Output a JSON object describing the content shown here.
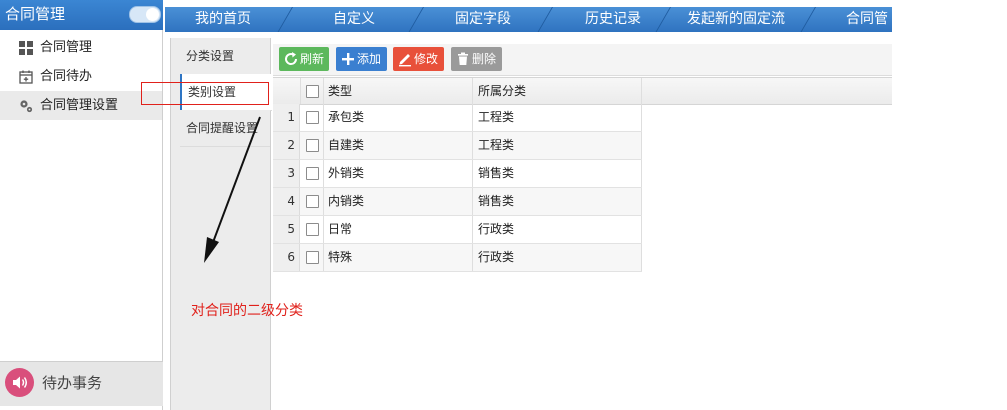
{
  "sidebar": {
    "title": "合同管理",
    "items": [
      {
        "label": "合同管理",
        "icon": "grid-icon"
      },
      {
        "label": "合同待办",
        "icon": "calendar-add-icon"
      },
      {
        "label": "合同管理设置",
        "icon": "gears-icon"
      }
    ],
    "footer_label": "待办事务"
  },
  "topnav": {
    "tabs": [
      "我的首页",
      "自定义",
      "固定字段",
      "历史记录",
      "发起新的固定流",
      "合同管"
    ]
  },
  "subtabs": [
    "分类设置",
    "类别设置",
    "合同提醒设置"
  ],
  "toolbar": {
    "refresh": "刷新",
    "add": "添加",
    "edit": "修改",
    "delete": "删除"
  },
  "grid": {
    "columns": [
      "类型",
      "所属分类"
    ],
    "rows": [
      {
        "n": "1",
        "type": "承包类",
        "category": "工程类"
      },
      {
        "n": "2",
        "type": "自建类",
        "category": "工程类"
      },
      {
        "n": "3",
        "type": "外销类",
        "category": "销售类"
      },
      {
        "n": "4",
        "type": "内销类",
        "category": "销售类"
      },
      {
        "n": "5",
        "type": "日常",
        "category": "行政类"
      },
      {
        "n": "6",
        "type": "特殊",
        "category": "行政类"
      }
    ]
  },
  "annotation": "对合同的二级分类",
  "colors": {
    "nav_blue": "#2f73c0",
    "refresh_green": "#5cb85c",
    "add_blue": "#3a7fd0",
    "edit_red": "#e8503a",
    "delete_gray": "#9a9a9a",
    "annotation_red": "#e0211b",
    "speaker_pink": "#d94f7c"
  }
}
